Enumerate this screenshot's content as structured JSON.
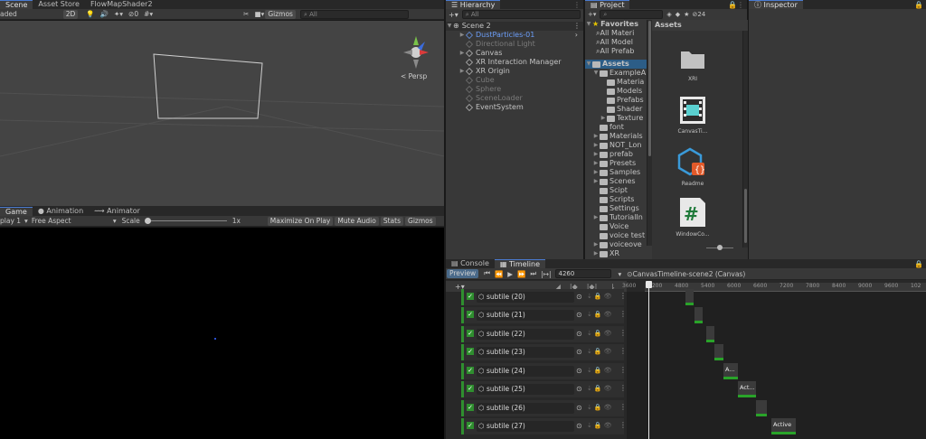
{
  "scene": {
    "tabs": [
      "Scene",
      "Asset Store",
      "FlowMapShader2"
    ],
    "toolbar": {
      "shading": "aded",
      "mode_2d": "2D",
      "gizmos": "Gizmos",
      "search_placeholder": "All",
      "layers_count": "0"
    },
    "persp_label": "< Persp"
  },
  "game": {
    "tabs": [
      "Game",
      "Animation",
      "Animator"
    ],
    "display": "play 1",
    "aspect": "Free Aspect",
    "scale_label": "Scale",
    "scale_value": "1x",
    "buttons": [
      "Maximize On Play",
      "Mute Audio",
      "Stats",
      "Gizmos"
    ]
  },
  "hierarchy": {
    "tab": "Hierarchy",
    "search_placeholder": "All",
    "scene_name": "Scene 2",
    "items": [
      {
        "label": "DustParticles-01",
        "style": "blue"
      },
      {
        "label": "Directional Light",
        "style": "dim"
      },
      {
        "label": "Canvas",
        "style": "normal"
      },
      {
        "label": "XR Interaction Manager",
        "style": "normal"
      },
      {
        "label": "XR Origin",
        "style": "normal"
      },
      {
        "label": "Cube",
        "style": "dim"
      },
      {
        "label": "Sphere",
        "style": "dim"
      },
      {
        "label": "SceneLoader",
        "style": "dim"
      },
      {
        "label": "EventSystem",
        "style": "normal"
      }
    ]
  },
  "project": {
    "tab": "Project",
    "count": "24",
    "favorites_label": "Favorites",
    "favorites": [
      "All Materi",
      "All Model",
      "All Prefab"
    ],
    "assets_label": "Assets",
    "tree": [
      "ExampleA",
      "Materia",
      "Models",
      "Prefabs",
      "Shader",
      "Texture",
      "font",
      "Materials",
      "NOT_Lon",
      "prefab",
      "Presets",
      "Samples",
      "Scenes",
      "Scipt",
      "Scripts",
      "Settings",
      "TutorialIn",
      "Voice",
      "voice test",
      "voiceove",
      "XR"
    ],
    "header": "Assets",
    "grid": [
      "XRI",
      "CanvasTi...",
      "Readme",
      "WindowCo..."
    ]
  },
  "inspector": {
    "tab": "Inspector"
  },
  "timeline": {
    "tabs": [
      "Console",
      "Timeline"
    ],
    "preview": "Preview",
    "frame": "4260",
    "asset": "CanvasTimeline-scene2 (Canvas)",
    "ruler": [
      "3600",
      "4200",
      "4800",
      "5400",
      "6000",
      "6600",
      "7200",
      "7800",
      "8400",
      "9000",
      "9600",
      "102"
    ],
    "tracks": [
      "subtile (20)",
      "subtile (21)",
      "subtile (22)",
      "subtile (23)",
      "subtile (24)",
      "subtile (25)",
      "subtile (26)",
      "subtile (27)"
    ],
    "clip_labels": [
      "A...",
      "Act...",
      "Active"
    ]
  }
}
